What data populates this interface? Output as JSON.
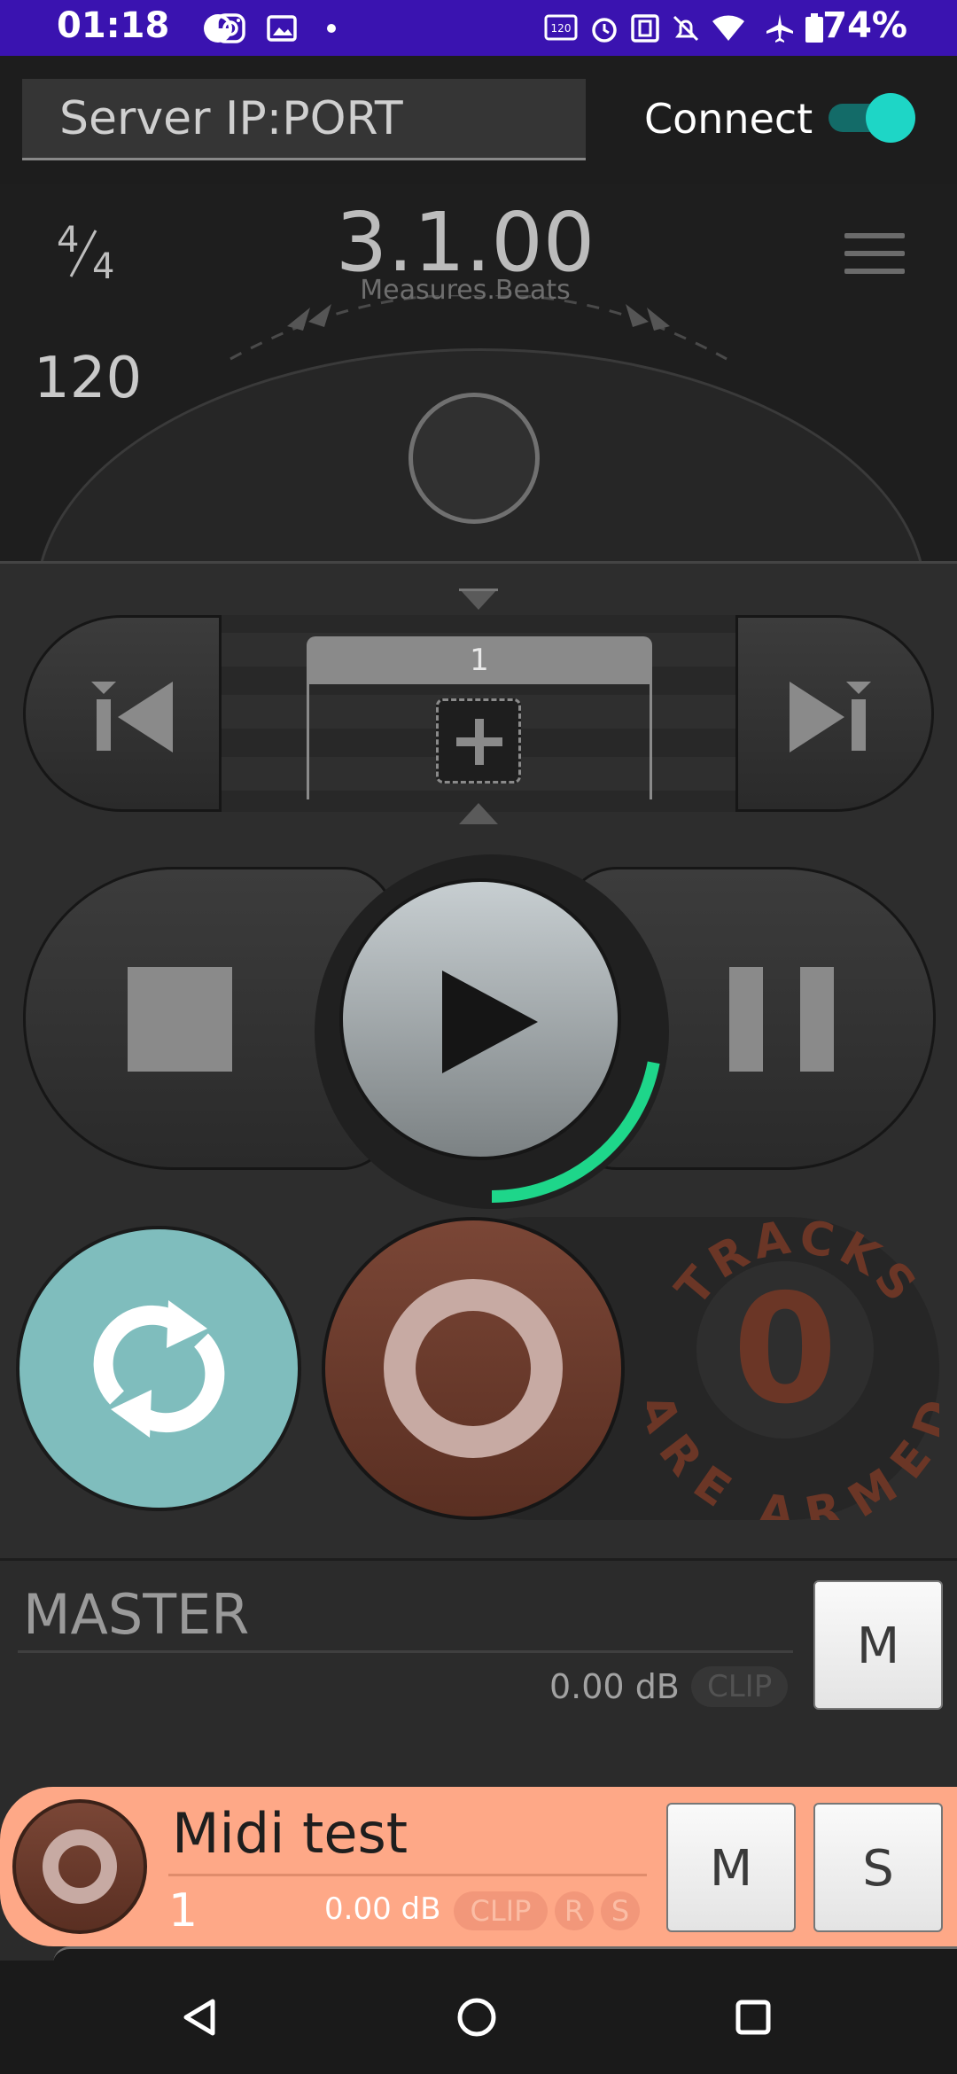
{
  "status_bar": {
    "time": "01:18",
    "battery": "74%",
    "left_icons": [
      "data-saver-icon",
      "instagram-icon",
      "gallery-icon",
      "dot-icon"
    ],
    "right_icons": [
      "refresh-rate-120hz-icon",
      "alarm-icon",
      "nfc-icon",
      "bell-off-icon",
      "wifi-icon",
      "airplane-icon",
      "battery-icon"
    ],
    "background": "#3a13b0"
  },
  "connect_bar": {
    "server_placeholder": "Server IP:PORT",
    "connect_label": "Connect",
    "connect_enabled": true,
    "accent": "#1ed6c6"
  },
  "transport_header": {
    "time_sig_numerator": "4",
    "time_sig_denominator": "4",
    "position": "3.1.00",
    "position_format": "Measures.Beats",
    "tempo": "120"
  },
  "marker_strip": {
    "marker_label": "1"
  },
  "transport": {
    "play_progress": 0.22,
    "progress_color": "#1ed68a"
  },
  "record_panel": {
    "armed_count": "0",
    "armed_top_text": "TRACKS",
    "armed_bottom_text": "ARE ARMED",
    "armed_color": "#6b3626"
  },
  "master": {
    "title": "MASTER",
    "db": "0.00 dB",
    "clip_label": "CLIP",
    "mute_label": "M"
  },
  "track": {
    "name": "Midi test",
    "number": "1",
    "db": "0.00 dB",
    "clip_label": "CLIP",
    "rec_label": "R",
    "solo_small_label": "S",
    "mute_label": "M",
    "solo_label": "S",
    "color": "#fea887"
  },
  "nav_bar": {
    "icons": [
      "back-icon",
      "home-icon",
      "recents-icon"
    ]
  }
}
